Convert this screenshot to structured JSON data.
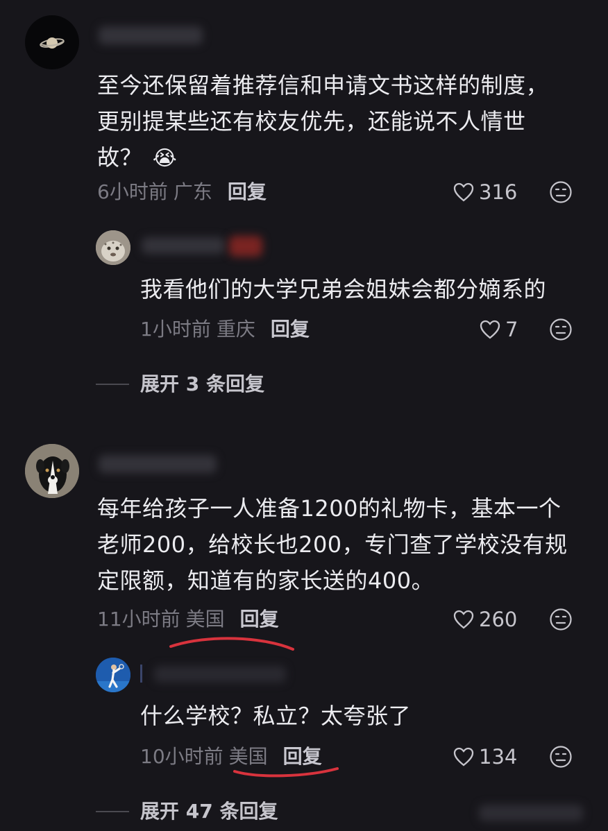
{
  "comments": [
    {
      "text": "至今还保留着推荐信和申请文书这样的制度，更别提某些还有校友优先，还能说不人情世故？",
      "emoji": "😭",
      "time": "6小时前",
      "location": "广东",
      "reply_label": "回复",
      "likes": "316",
      "replies": [
        {
          "text": "我看他们的大学兄弟会姐妹会都分嫡系的",
          "time": "1小时前",
          "location": "重庆",
          "reply_label": "回复",
          "likes": "7"
        }
      ],
      "expand_label": "展开 3 条回复"
    },
    {
      "text": "每年给孩子一人准备1200的礼物卡，基本一个老师200，给校长也200，专门查了学校没有规定限额，知道有的家长送的400。",
      "time": "11小时前",
      "location": "美国",
      "reply_label": "回复",
      "likes": "260",
      "replies": [
        {
          "text": "什么学校？私立？太夸张了",
          "time": "10小时前",
          "location": "美国",
          "reply_label": "回复",
          "likes": "134"
        }
      ],
      "expand_label": "展开 47 条回复"
    }
  ],
  "colors": {
    "background": "#17161b",
    "annotation": "#d8333d",
    "meta": "#7c7b84"
  },
  "icons": {
    "like": "heart-outline-icon",
    "react": "neutral-face-icon"
  }
}
